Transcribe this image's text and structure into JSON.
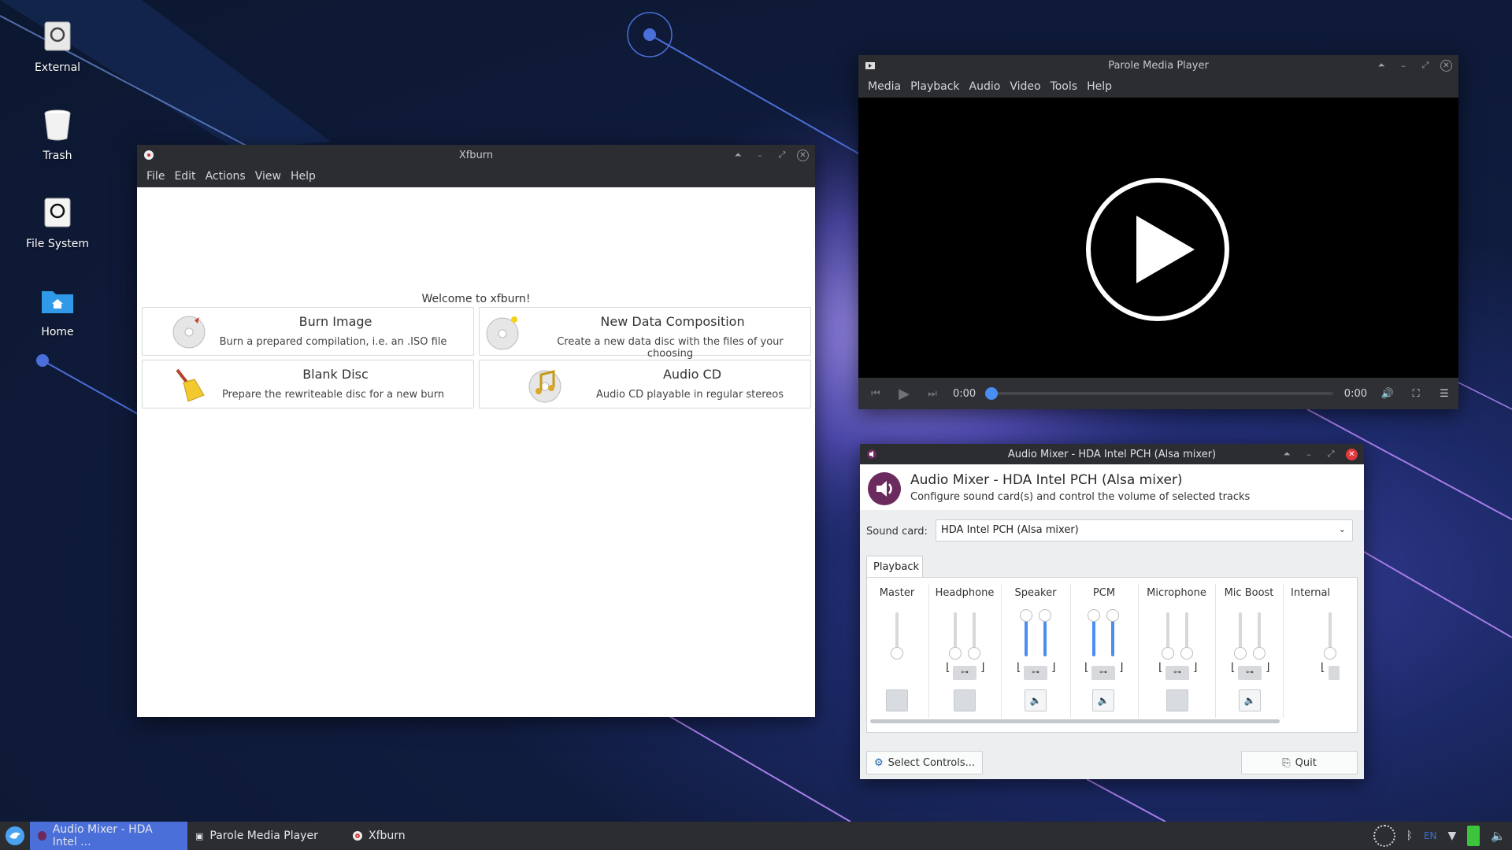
{
  "desktop": {
    "icons": [
      {
        "label": "External",
        "icon": "drive-icon"
      },
      {
        "label": "Trash",
        "icon": "trash-icon"
      },
      {
        "label": "File System",
        "icon": "drive-icon"
      },
      {
        "label": "Home",
        "icon": "home-folder-icon"
      }
    ]
  },
  "xfburn": {
    "title": "Xfburn",
    "menu": [
      "File",
      "Edit",
      "Actions",
      "View",
      "Help"
    ],
    "welcome": "Welcome to xfburn!",
    "actions": [
      {
        "title": "Burn Image",
        "desc": "Burn a prepared compilation, i.e. an .ISO file",
        "icon": "disc-burn-icon"
      },
      {
        "title": "New Data Composition",
        "desc": "Create a new data disc with the files of your choosing",
        "icon": "data-disc-icon"
      },
      {
        "title": "Blank Disc",
        "desc": "Prepare the rewriteable disc for a new burn",
        "icon": "broom-icon"
      },
      {
        "title": "Audio CD",
        "desc": "Audio CD playable in regular stereos",
        "icon": "audio-disc-icon"
      }
    ]
  },
  "parole": {
    "title": "Parole Media Player",
    "menu": [
      "Media",
      "Playback",
      "Audio",
      "Video",
      "Tools",
      "Help"
    ],
    "time_current": "0:00",
    "time_total": "0:00",
    "progress": 0
  },
  "mixer": {
    "title": "Audio Mixer - HDA Intel PCH (Alsa mixer)",
    "header_title": "Audio Mixer - HDA Intel PCH (Alsa mixer)",
    "header_sub": "Configure sound card(s) and control the volume of selected tracks",
    "soundcard_label": "Sound card:",
    "soundcard_value": "HDA Intel PCH (Alsa mixer)",
    "tab": "Playback",
    "channels": [
      {
        "name": "Master",
        "stereo": false,
        "level": 0
      },
      {
        "name": "Headphone",
        "stereo": true,
        "level": 0
      },
      {
        "name": "Speaker",
        "stereo": true,
        "level": 1
      },
      {
        "name": "PCM",
        "stereo": true,
        "level": 1
      },
      {
        "name": "Microphone",
        "stereo": true,
        "level": 0
      },
      {
        "name": "Mic Boost",
        "stereo": true,
        "level": 0
      },
      {
        "name": "Internal",
        "stereo": true,
        "level": 0
      }
    ],
    "select_controls": "Select Controls...",
    "quit": "Quit"
  },
  "taskbar": {
    "items": [
      {
        "label": "Audio Mixer - HDA Intel ...",
        "active": true
      },
      {
        "label": "Parole Media Player",
        "active": false
      },
      {
        "label": "Xfburn",
        "active": false
      }
    ],
    "keyboard_layout": "EN"
  },
  "colors": {
    "accent": "#4a8ef4",
    "titlebar": "#2b2d31",
    "close_red": "#e0393e",
    "taskbar_active": "#4a6fd8"
  }
}
